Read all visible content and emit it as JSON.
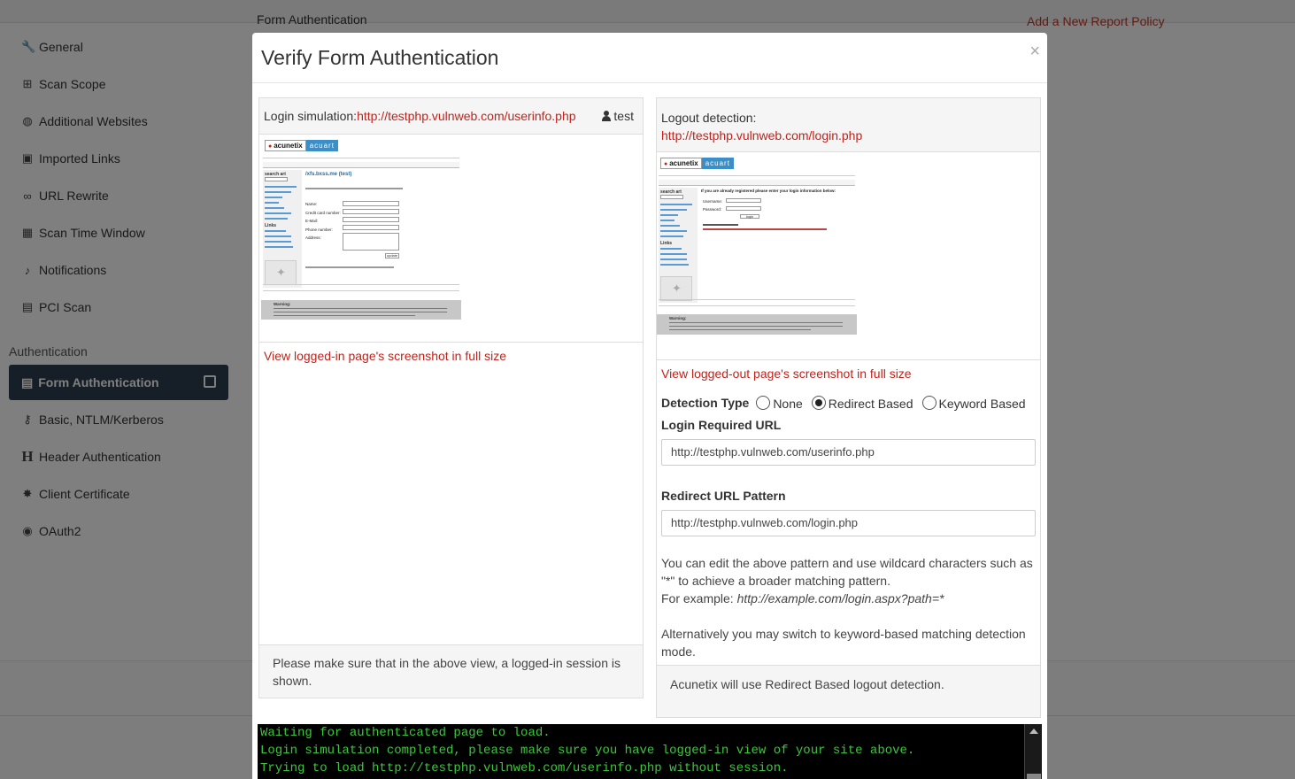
{
  "background": {
    "top_left_text": "Form Authentication",
    "top_right_text": "Add a New Report Policy",
    "sidebar": {
      "items": [
        {
          "label": "General",
          "icon": "wrench-icon"
        },
        {
          "label": "Scan Scope",
          "icon": "sitemap-icon"
        },
        {
          "label": "Additional Websites",
          "icon": "globe-icon"
        },
        {
          "label": "Imported Links",
          "icon": "file-import-icon"
        },
        {
          "label": "URL Rewrite",
          "icon": "link-icon"
        },
        {
          "label": "Scan Time Window",
          "icon": "calendar-icon"
        },
        {
          "label": "Notifications",
          "icon": "bell-icon"
        },
        {
          "label": "PCI Scan",
          "icon": "pci-icon"
        }
      ],
      "section_title": "Authentication",
      "active_item": {
        "label": "Form Authentication",
        "icon": "form-icon"
      },
      "auth_items": [
        {
          "label": "Basic, NTLM/Kerberos",
          "icon": "key-icon"
        },
        {
          "label": "Header Authentication",
          "icon": "header-icon"
        },
        {
          "label": "Client Certificate",
          "icon": "certificate-icon"
        },
        {
          "label": "OAuth2",
          "icon": "oauth-icon"
        }
      ]
    }
  },
  "modal": {
    "title": "Verify Form Authentication",
    "close": "×",
    "left": {
      "label": "Login simulation:",
      "url": "http://testphp.vulnweb.com/userinfo.php",
      "user": "test",
      "view_link": "View logged-in page's screenshot in full size",
      "footer": "Please make sure that in the above view, a logged-in session is shown."
    },
    "right": {
      "label": "Logout detection:",
      "url": "http://testphp.vulnweb.com/login.php",
      "view_link": "View logged-out page's screenshot in full size",
      "detection_label": "Detection Type",
      "options": [
        "None",
        "Redirect Based",
        "Keyword Based"
      ],
      "selected": "Redirect Based",
      "login_required_label": "Login Required URL",
      "login_required_value": "http://testphp.vulnweb.com/userinfo.php",
      "redirect_label": "Redirect URL Pattern",
      "redirect_value": "http://testphp.vulnweb.com/login.php",
      "help_1": "You can edit the above pattern and use wildcard characters such as \"*\" to achieve a broader matching pattern.",
      "help_example_prefix": "For example: ",
      "help_example": "http://example.com/login.aspx?path=*",
      "help_2": "Alternatively you may switch to keyword-based matching detection mode.",
      "footer": "Acunetix will use Redirect Based logout detection."
    },
    "console": [
      "Waiting for authenticated page to load.",
      "Login simulation completed, please make sure you have logged-in view of your site above.",
      "Trying to load http://testphp.vulnweb.com/userinfo.php without session."
    ],
    "mock_left": {
      "logo_a": "acunetix",
      "logo_b": "acuart",
      "heading": "/xfs.bxss.me (test)",
      "fields": [
        "Name:",
        "Credit card number:",
        "E-Mail:",
        "Phone number:",
        "Address:"
      ],
      "button": "update",
      "sidebar_title": "search art",
      "links_title": "Links",
      "warning": "Warning:"
    },
    "mock_right": {
      "logo_a": "acunetix",
      "logo_b": "acuart",
      "heading": "If you are already registered please enter your login information below:",
      "fields": [
        "Username:",
        "Password:"
      ],
      "button": "login",
      "sidebar_title": "search art",
      "links_title": "Links",
      "warning": "Warning:"
    },
    "colors": {
      "link": "#c0231b",
      "console_bg": "#000000",
      "console_text": "#3ec63e",
      "sidebar_active": "#2c3e50"
    }
  }
}
